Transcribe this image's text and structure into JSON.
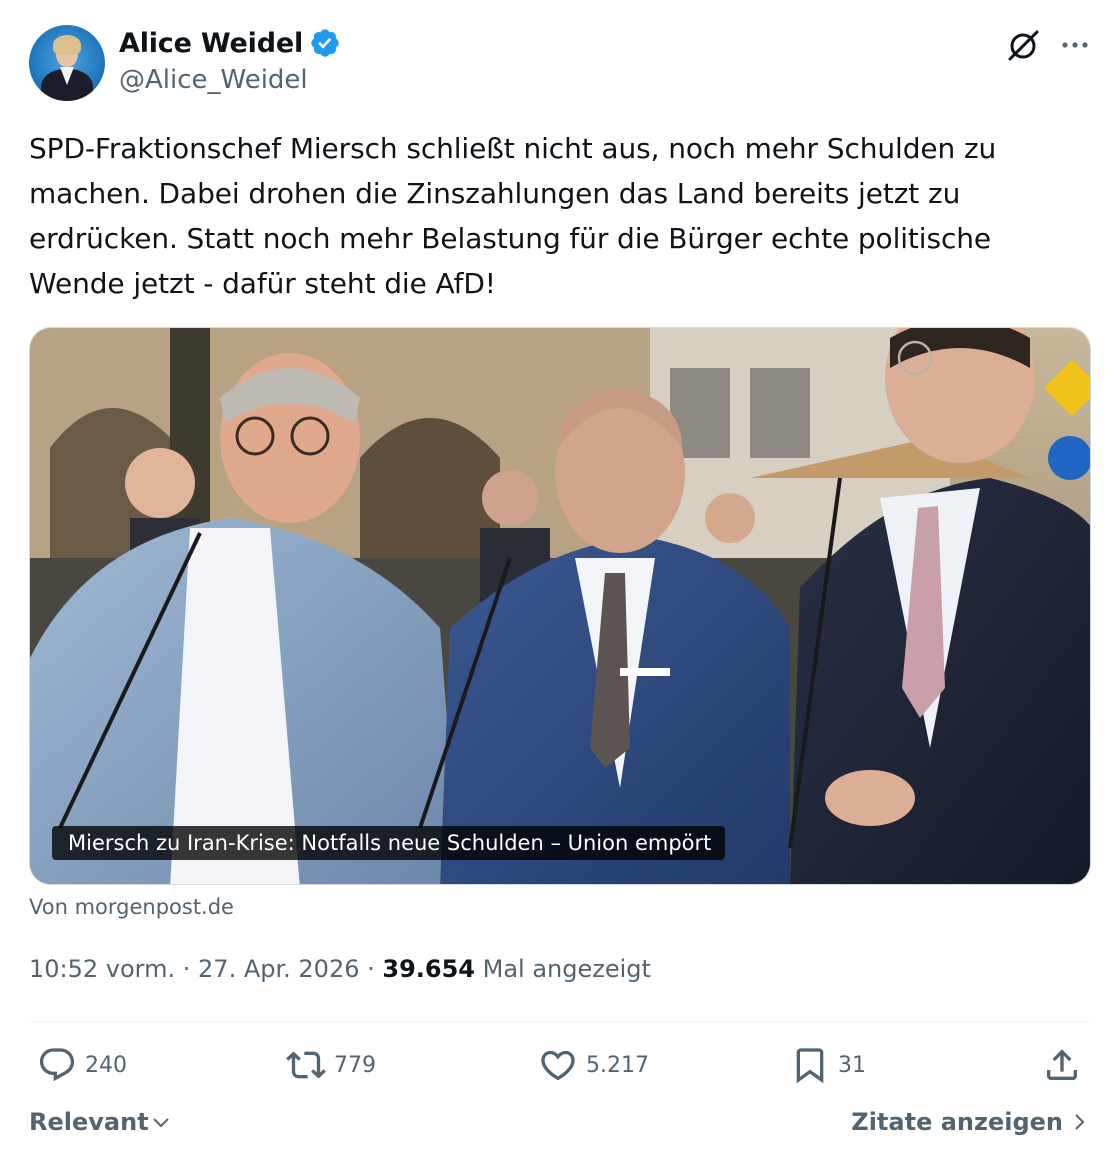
{
  "author": {
    "display_name": "Alice Weidel",
    "handle": "@Alice_Weidel",
    "verified": true
  },
  "header_actions": {
    "grok_icon": "grok-slash-icon",
    "more_icon": "more-dots-icon"
  },
  "tweet": {
    "text": "SPD-Fraktionschef Miersch schließt nicht aus, noch mehr Schulden zu machen. Dabei drohen die Zinszahlungen das Land bereits jetzt zu erdrücken. Statt noch mehr Belastung für die Bürger echte politische Wende jetzt - dafür steht die AfD!"
  },
  "card": {
    "caption": "Miersch zu Iran-Krise: Notfalls neue Schulden – Union empört",
    "source": "Von morgenpost.de"
  },
  "meta": {
    "time": "10:52 vorm.",
    "separator1": " · ",
    "date": "27. Apr. 2026",
    "separator2": " · ",
    "views": "39.654",
    "views_label": " Mal angezeigt"
  },
  "actions": {
    "replies": "240",
    "reposts": "779",
    "likes": "5.217",
    "bookmarks": "31"
  },
  "footer": {
    "sort_label": "Relevant",
    "quotes_label": "Zitate anzeigen"
  },
  "colors": {
    "text": "#0f1419",
    "secondary": "#536471",
    "verified": "#1d9bf0",
    "border": "#cfd9de"
  }
}
